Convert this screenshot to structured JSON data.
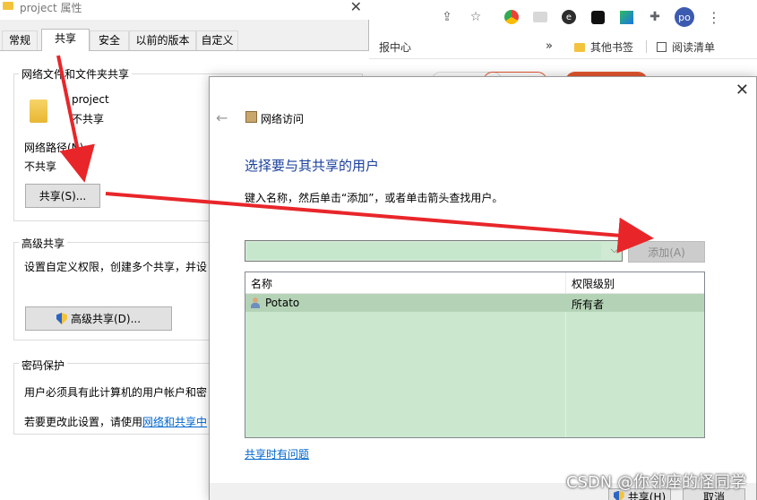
{
  "browser": {
    "bookmarks": {
      "partial_item": "报中心",
      "more": "»",
      "other_bookmarks": "其他书签",
      "reading_list": "阅读清单"
    },
    "profile_initials": "po",
    "colors": {
      "profile": "#3c5bb0",
      "pill_red": "#e4572e"
    }
  },
  "properties": {
    "title": "project 属性",
    "tabs": [
      {
        "label": "常规"
      },
      {
        "label": "共享"
      },
      {
        "label": "安全"
      },
      {
        "label": "以前的版本"
      },
      {
        "label": "自定义"
      }
    ],
    "network_share": {
      "group_title": "网络文件和文件夹共享",
      "folder_name": "project",
      "folder_status": "不共享",
      "path_label": "网络路径(N):",
      "path_value": "不共享",
      "share_button": "共享(S)..."
    },
    "advanced": {
      "group_title": "高级共享",
      "description": "设置自定义权限，创建多个共享，并设",
      "button": "高级共享(D)..."
    },
    "password": {
      "group_title": "密码保护",
      "description": "用户必须具有此计算机的用户帐户和密",
      "change_prefix": "若要更改此设置，请使用",
      "change_link": "网络和共享中"
    }
  },
  "network_access": {
    "nav_title": "网络访问",
    "heading": "选择要与其共享的用户",
    "hint": "键入名称，然后单击“添加”，或者单击箭头查找用户。",
    "input_value": "",
    "add_button": "添加(A)",
    "columns": [
      "名称",
      "权限级别"
    ],
    "rows": [
      {
        "name": "Potato",
        "permission": "所有者"
      }
    ],
    "trouble_link": "共享时有问题",
    "share_button": "共享(H)",
    "cancel_button": "取消",
    "colors": {
      "heading": "#1a3f9c",
      "table_bg": "#cbe8cf",
      "selected_row": "#b4d3b6"
    }
  },
  "annotation_color": "#e8262a",
  "watermark": "CSDN @你邻座的怪同学"
}
